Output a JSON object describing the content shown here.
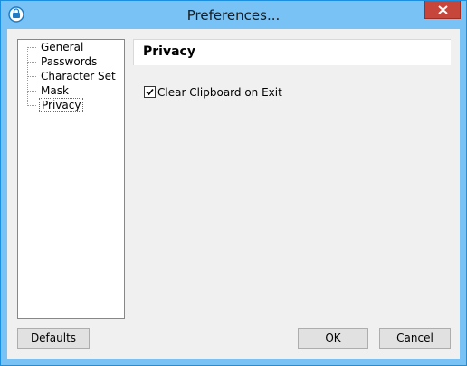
{
  "window": {
    "title": "Preferences...",
    "app_icon": "app-icon",
    "close_icon": "close-icon"
  },
  "sidebar": {
    "items": [
      {
        "label": "General",
        "selected": false
      },
      {
        "label": "Passwords",
        "selected": false
      },
      {
        "label": "Character Set",
        "selected": false
      },
      {
        "label": "Mask",
        "selected": false
      },
      {
        "label": "Privacy",
        "selected": true
      }
    ]
  },
  "panel": {
    "title": "Privacy",
    "options": [
      {
        "label": "Clear Clipboard on Exit",
        "checked": true
      }
    ]
  },
  "buttons": {
    "defaults": "Defaults",
    "ok": "OK",
    "cancel": "Cancel"
  },
  "colors": {
    "titlebar": "#78c2f5",
    "close_button": "#c7463b",
    "client_bg": "#f0f0f0"
  }
}
